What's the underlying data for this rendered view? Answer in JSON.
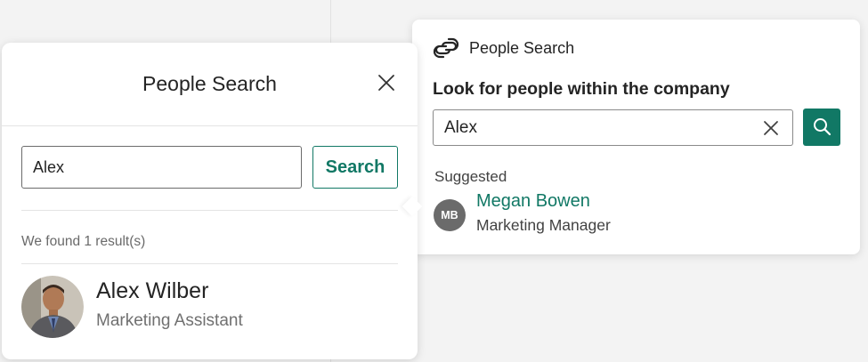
{
  "left_panel": {
    "title": "People Search",
    "search_value": "Alex",
    "search_button_label": "Search",
    "results_text": "We found 1 result(s)",
    "result": {
      "name": "Alex Wilber",
      "title": "Marketing Assistant"
    }
  },
  "right_panel": {
    "app_name": "People Search",
    "heading": "Look for people within the company",
    "search_value": "Alex",
    "suggested_label": "Suggested",
    "suggestion": {
      "initials": "MB",
      "name": "Megan Bowen",
      "role": "Marketing Manager"
    }
  },
  "colors": {
    "accent": "#117865",
    "avatar_gray": "#6b6b6b"
  },
  "icons": [
    "close-icon",
    "app-logo-icon",
    "clear-icon",
    "search-icon"
  ]
}
